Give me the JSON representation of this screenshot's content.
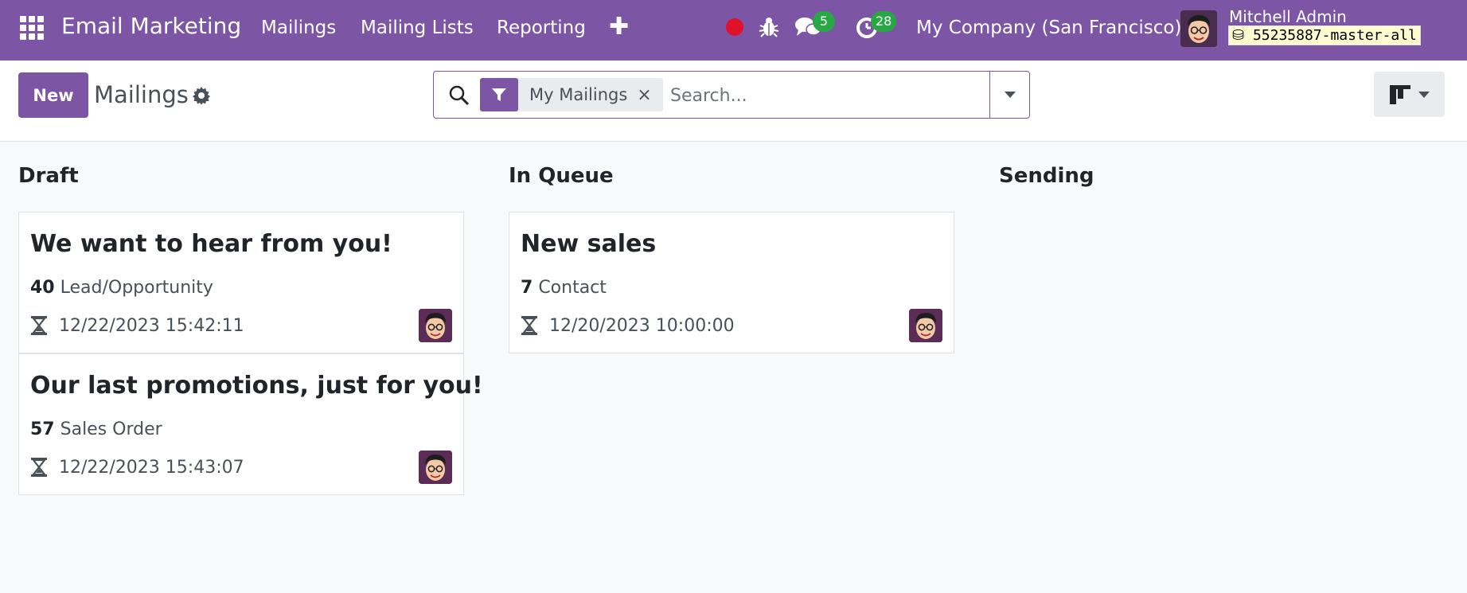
{
  "navbar": {
    "brand": "Email Marketing",
    "menu": [
      "Mailings",
      "Mailing Lists",
      "Reporting"
    ],
    "messages_badge": "5",
    "activities_badge": "28",
    "company": "My Company (San Francisco)",
    "user_name": "Mitchell Admin",
    "db_name": "55235887-master-all",
    "accent_color": "#7c55a4"
  },
  "control_panel": {
    "new_label": "New",
    "title": "Mailings",
    "facet_label": "My Mailings",
    "facet_close": "×",
    "search_placeholder": "Search..."
  },
  "kanban": {
    "columns": [
      {
        "title": "Draft",
        "cards": [
          {
            "title": "We want to hear from you!",
            "count": "40",
            "model": "Lead/Opportunity",
            "date": "12/22/2023 15:42:11"
          },
          {
            "title": "Our last promotions, just for you!",
            "count": "57",
            "model": "Sales Order",
            "date": "12/22/2023 15:43:07"
          }
        ]
      },
      {
        "title": "In Queue",
        "cards": [
          {
            "title": "New sales",
            "count": "7",
            "model": "Contact",
            "date": "12/20/2023 10:00:00"
          }
        ]
      },
      {
        "title": "Sending",
        "cards": []
      }
    ]
  }
}
